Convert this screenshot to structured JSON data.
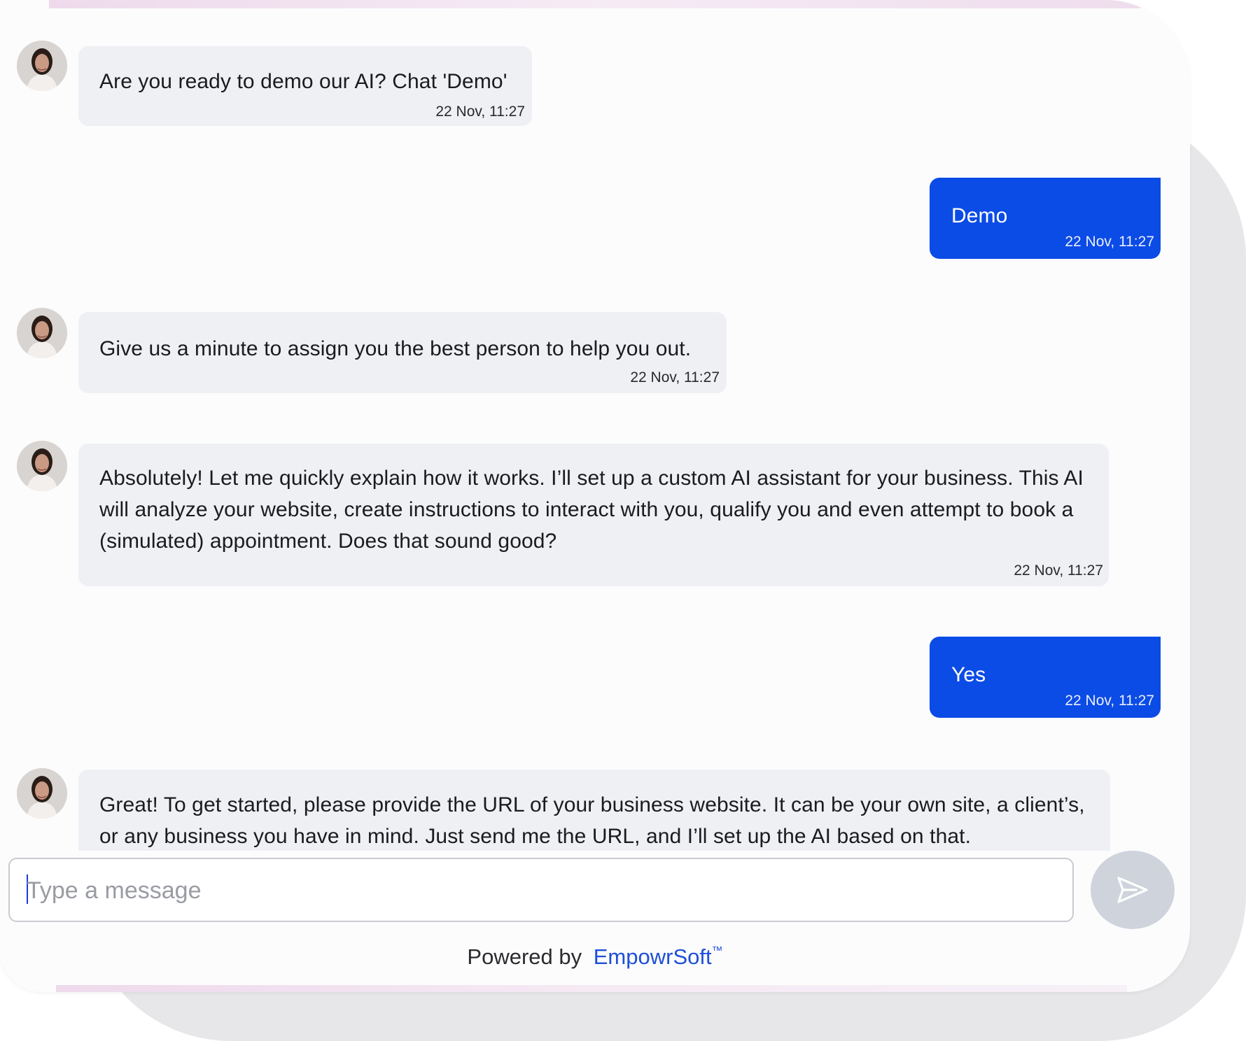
{
  "messages": [
    {
      "sender": "agent",
      "text": "Are you ready to demo our AI? Chat 'Demo'",
      "time": "22 Nov, 11:27"
    },
    {
      "sender": "user",
      "text": "Demo",
      "time": "22 Nov, 11:27"
    },
    {
      "sender": "agent",
      "text": "Give us a minute to assign you the best person to help you out.",
      "time": "22 Nov, 11:27"
    },
    {
      "sender": "agent",
      "text": "Absolutely! Let me quickly explain how it works. I’ll set up a custom AI assistant for your business. This AI will analyze your website, create instructions to interact with you, qualify you and even attempt to book a (simulated) appointment. Does that sound good?",
      "time": "22 Nov, 11:27"
    },
    {
      "sender": "user",
      "text": "Yes",
      "time": "22 Nov, 11:27"
    },
    {
      "sender": "agent",
      "text": "Great! To get started, please provide the URL of your business website. It can be your own site, a client’s, or any business you have in mind. Just send me the URL, and I’ll set up the AI based on that."
    }
  ],
  "composer": {
    "placeholder": "Type a message",
    "send_icon": "paper-plane-icon"
  },
  "footer": {
    "powered_by": "Powered by",
    "brand": "EmpowrSoft",
    "trademark": "™"
  },
  "colors": {
    "user_bubble": "#0b4be6",
    "agent_bubble": "#eff0f4",
    "brand": "#1f4fd8",
    "send_button": "#ced3dc"
  }
}
